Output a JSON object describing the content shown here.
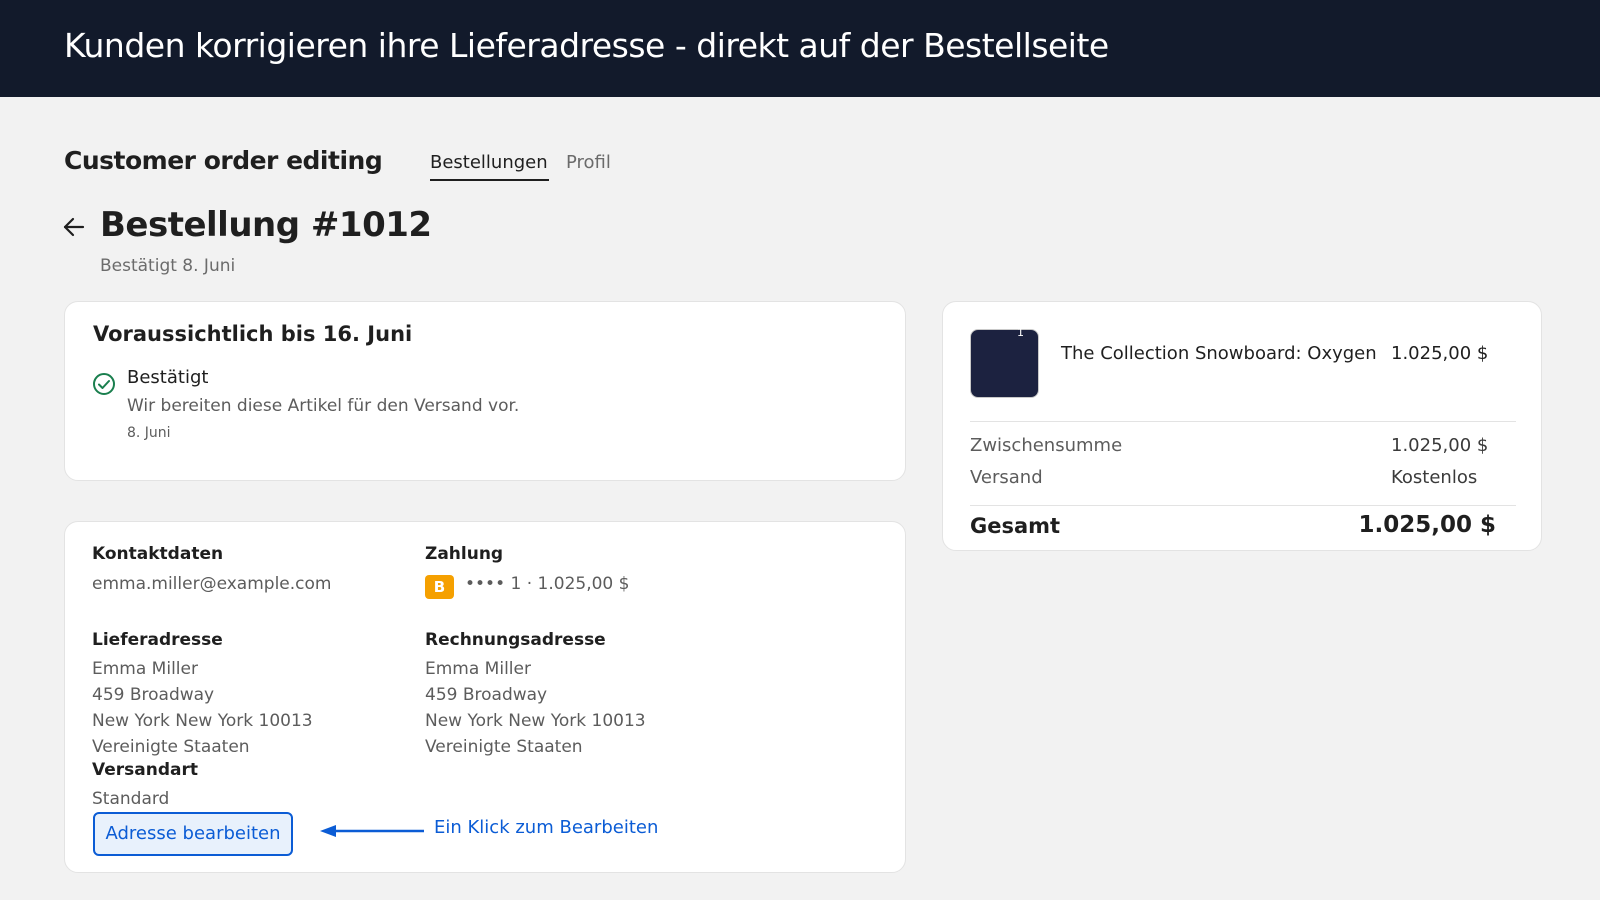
{
  "banner": {
    "title": "Kunden korrigieren ihre Lieferadresse - direkt auf der Bestellseite"
  },
  "header": {
    "shop_name": "Customer order editing",
    "tabs": [
      {
        "label": "Bestellungen",
        "active": true
      },
      {
        "label": "Profil",
        "active": false
      }
    ]
  },
  "order": {
    "title": "Bestellung #1012",
    "subtitle": "Bestätigt 8. Juni"
  },
  "status_card": {
    "heading": "Voraussichtlich bis 16. Juni",
    "status_label": "Bestätigt",
    "status_description": "Wir bereiten diese Artikel für den Versand vor.",
    "status_date": "8. Juni",
    "status_icon": "check-circle-icon"
  },
  "info_card": {
    "contact": {
      "label": "Kontaktdaten",
      "value": "emma.miller@example.com"
    },
    "payment": {
      "label": "Zahlung",
      "badge": "B",
      "value": "•••• 1 · 1.025,00 $",
      "badge_color": "#f5a000"
    },
    "shipping_address": {
      "label": "Lieferadresse",
      "lines": [
        "Emma Miller",
        "459 Broadway",
        "New York New York 10013",
        "Vereinigte Staaten"
      ]
    },
    "billing_address": {
      "label": "Rechnungsadresse",
      "lines": [
        "Emma Miller",
        "459 Broadway",
        "New York New York 10013",
        "Vereinigte Staaten"
      ]
    },
    "shipping_method": {
      "label": "Versandart",
      "value": "Standard"
    },
    "edit_button": "Adresse bearbeiten"
  },
  "annotation": {
    "text": "Ein Klick zum Bearbeiten",
    "color": "#0b5cd5"
  },
  "summary": {
    "product": {
      "quantity": "1",
      "name": "The Collection Snowboard: Oxygen",
      "price": "1.025,00 $"
    },
    "subtotal": {
      "label": "Zwischensumme",
      "value": "1.025,00 $"
    },
    "shipping": {
      "label": "Versand",
      "value": "Kostenlos"
    },
    "total": {
      "label": "Gesamt",
      "value": "1.025,00 $"
    }
  },
  "colors": {
    "banner": "#121a2b",
    "accent": "#0b5cd5",
    "success": "#1a7f4e",
    "thumbnail": "#1c2240"
  }
}
